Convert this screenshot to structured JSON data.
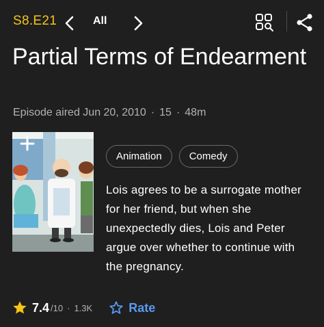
{
  "header": {
    "episode_code": "S8.E21",
    "all_label": "All"
  },
  "episode": {
    "title": "Partial Terms of Endearment",
    "aired": "Episode aired Jun 20, 2010",
    "rating_label": "15",
    "runtime": "48m",
    "meta_separator": "·"
  },
  "genres": [
    "Animation",
    "Comedy"
  ],
  "plot": "Lois agrees to be a surrogate mother for her friend, but when she unexpectedly dies, Lois and Peter argue over whether to continue with the pregnancy.",
  "rating": {
    "score": "7.4",
    "scale": "/10",
    "separator": "·",
    "votes": "1.3K",
    "rate_label": "Rate"
  },
  "colors": {
    "accent_yellow": "#f5c518",
    "link_blue": "#5799ef",
    "background": "#1f1f1f"
  },
  "icons": {
    "prev": "chevron-left-icon",
    "next": "chevron-right-icon",
    "grid": "grid-search-icon",
    "share": "share-icon",
    "add": "plus-icon",
    "star": "star-filled-icon",
    "rate": "star-outline-icon"
  }
}
